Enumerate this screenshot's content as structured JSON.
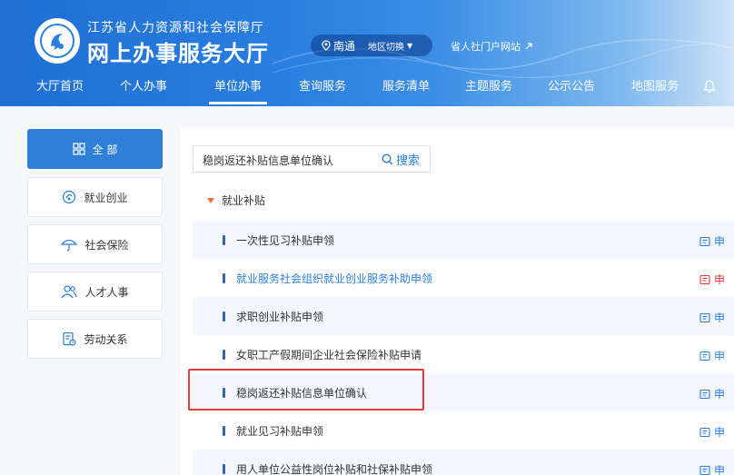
{
  "header": {
    "org_name": "江苏省人力资源和社会保障厅",
    "site_title": "网上办事服务大厅",
    "city": "南通",
    "switch_label": "地区切换",
    "portal_link": "省人社门户网站"
  },
  "nav": {
    "items": [
      "大厅首页",
      "个人办事",
      "单位办事",
      "查询服务",
      "服务清单",
      "主题服务",
      "公示公告",
      "地图服务"
    ],
    "active": "单位办事"
  },
  "sidebar": {
    "items": [
      {
        "label": "全 部",
        "icon": "grid-icon"
      },
      {
        "label": "就业创业",
        "icon": "employment-icon"
      },
      {
        "label": "社会保险",
        "icon": "umbrella-icon"
      },
      {
        "label": "人才人事",
        "icon": "people-icon"
      },
      {
        "label": "劳动关系",
        "icon": "document-icon"
      }
    ]
  },
  "search": {
    "value": "稳岗返还补贴信息单位确认",
    "button": "搜索"
  },
  "category": "就业补贴",
  "rows": [
    {
      "label": "一次性见习补贴申领",
      "action": "申"
    },
    {
      "label": "就业服务社会组织就业创业服务补助申领",
      "action": "申"
    },
    {
      "label": "求职创业补贴申领",
      "action": "申"
    },
    {
      "label": "女职工产假期间企业社会保险补贴申请",
      "action": "申"
    },
    {
      "label": "稳岗返还补贴信息单位确认",
      "action": "申"
    },
    {
      "label": "就业见习补贴申领",
      "action": "申"
    },
    {
      "label": "用人单位公益性岗位补贴和社保补贴申领",
      "action": "申"
    }
  ],
  "colors": {
    "accent": "#2e7fd8",
    "highlight": "#e53a35",
    "warning": "#d9383a"
  }
}
